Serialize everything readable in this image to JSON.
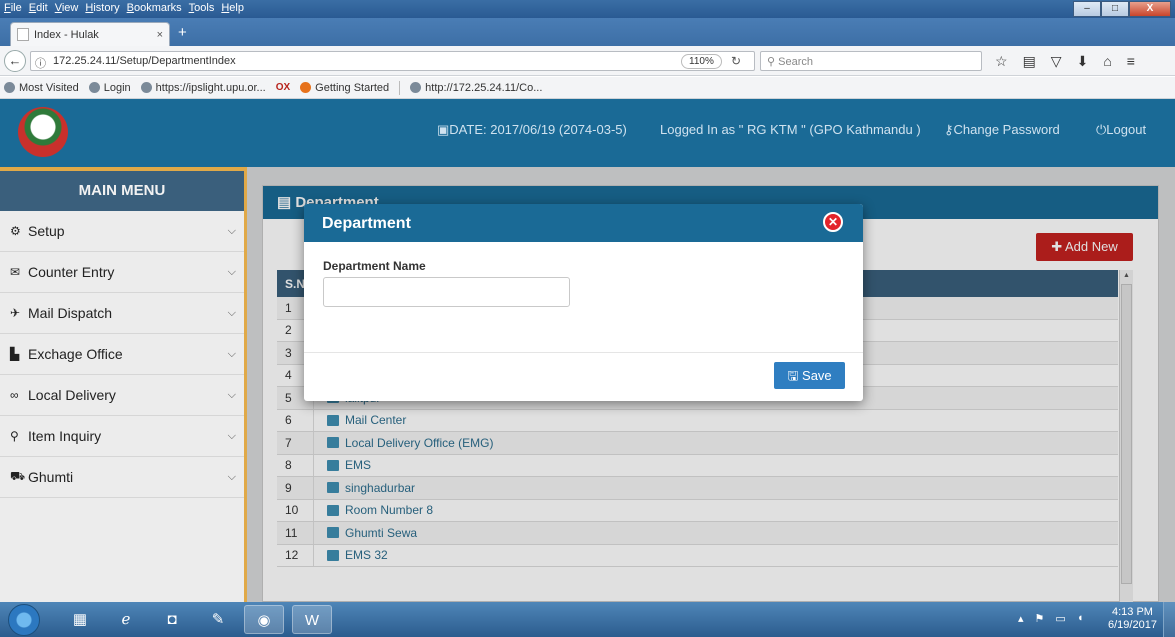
{
  "browser": {
    "menu": [
      "File",
      "Edit",
      "View",
      "History",
      "Bookmarks",
      "Tools",
      "Help"
    ],
    "window_controls": {
      "minimize": "–",
      "maximize": "□",
      "close": "X"
    },
    "tab_title": "Index - Hulak",
    "tab_close": "×",
    "new_tab": "+",
    "back": "←",
    "url": "172.25.24.11/Setup/DepartmentIndex",
    "zoom": "110%",
    "search_placeholder": "Search",
    "bookmarks": [
      "Most Visited",
      "Login",
      "https://ipslight.upu.or...",
      "Getting Started",
      "http://172.25.24.11/Co..."
    ]
  },
  "header": {
    "date": "DATE: 2017/06/19 (2074-03-5)",
    "user": "Logged In as \" RG KTM \" (GPO Kathmandu )",
    "change_password": "Change Password",
    "logout": "Logout"
  },
  "sidebar": {
    "title": "MAIN MENU",
    "items": [
      {
        "label": "Setup",
        "icon": "cogs-icon"
      },
      {
        "label": "Counter Entry",
        "icon": "envelope-icon"
      },
      {
        "label": "Mail Dispatch",
        "icon": "plane-icon"
      },
      {
        "label": "Exchage Office",
        "icon": "briefcase-icon"
      },
      {
        "label": "Local Delivery",
        "icon": "bicycle-icon"
      },
      {
        "label": "Item Inquiry",
        "icon": "search-icon"
      },
      {
        "label": "Ghumti",
        "icon": "car-icon"
      }
    ]
  },
  "panel": {
    "title": "Department",
    "add_new": "Add New",
    "table_header_sn": "S.N",
    "rows": [
      {
        "sn": "1",
        "name": ""
      },
      {
        "sn": "2",
        "name": ""
      },
      {
        "sn": "3",
        "name": ""
      },
      {
        "sn": "4",
        "name": ""
      },
      {
        "sn": "5",
        "name": "lalitpur"
      },
      {
        "sn": "6",
        "name": "Mail Center"
      },
      {
        "sn": "7",
        "name": " Local Delivery Office (EMG)"
      },
      {
        "sn": "8",
        "name": "EMS"
      },
      {
        "sn": "9",
        "name": "singhadurbar"
      },
      {
        "sn": "10",
        "name": "Room Number 8"
      },
      {
        "sn": "11",
        "name": "Ghumti Sewa"
      },
      {
        "sn": "12",
        "name": "EMS 32"
      }
    ]
  },
  "modal": {
    "title": "Department",
    "field_label": "Department Name",
    "field_value": "",
    "field_placeholder": "",
    "save": "Save"
  },
  "taskbar": {
    "time": "4:13 PM",
    "date": "6/19/2017"
  },
  "colors": {
    "header_blue": "#1a6a96",
    "sidebar_title": "#3a5f7c",
    "accent_orange": "#e0a948",
    "add_new_red": "#c3211f",
    "save_blue": "#2f7ec1"
  }
}
